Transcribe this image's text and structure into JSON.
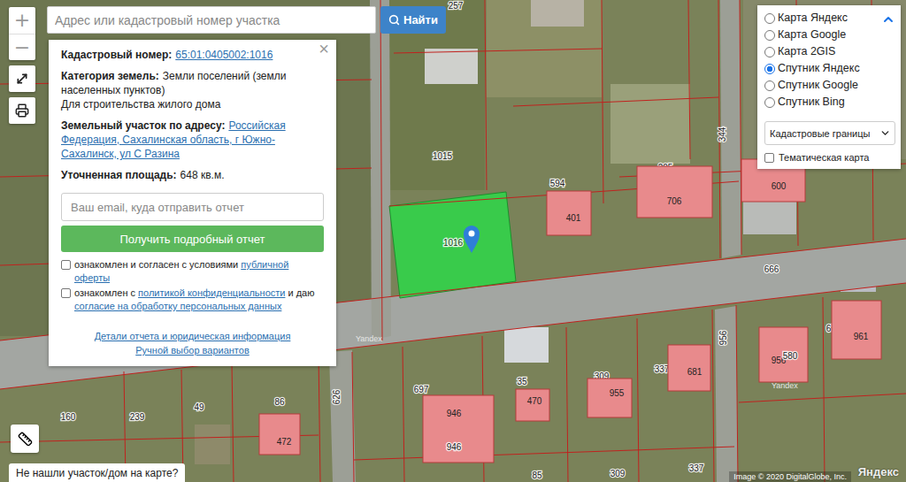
{
  "search": {
    "placeholder": "Адрес или кадастровый номер участка",
    "button": "Найти"
  },
  "zoom": {
    "in": "+",
    "out": "−"
  },
  "info_panel": {
    "close": "×",
    "cadastral_number": {
      "label": "Кадастровый номер:",
      "value": "65:01:0405002:1016"
    },
    "category": {
      "label": "Категория земель:",
      "value": "Земли поселений (земли населенных пунктов)",
      "purpose": "Для строительства жилого дома"
    },
    "address": {
      "label": "Земельный участок по адресу:",
      "value": "Российская Федерация, Сахалинская область, г Южно-Сахалинск, ул С Разина"
    },
    "area": {
      "label": "Уточненная площадь:",
      "value": "648 кв.м."
    },
    "email_placeholder": "Ваш email, куда отправить отчет",
    "report_button": "Получить подробный отчет",
    "agreements": [
      {
        "checked": false,
        "parts": [
          {
            "text": "ознакомлен и согласен с условиями ",
            "link": false
          },
          {
            "text": "публичной оферты",
            "link": true
          }
        ]
      },
      {
        "checked": false,
        "parts": [
          {
            "text": "ознакомлен с ",
            "link": false
          },
          {
            "text": "политикой конфиденциальности",
            "link": true
          },
          {
            "text": " и даю ",
            "link": false
          },
          {
            "text": "согласие на обработку персональных данных",
            "link": true
          }
        ]
      }
    ],
    "links": [
      "Детали отчета и юридическая информация",
      "Ручной выбор вариантов"
    ]
  },
  "layers": {
    "options": [
      {
        "label": "Карта Яндекс",
        "selected": false
      },
      {
        "label": "Карта Google",
        "selected": false
      },
      {
        "label": "Карта 2GIS",
        "selected": false
      },
      {
        "label": "Спутник Яндекс",
        "selected": true
      },
      {
        "label": "Спутник Google",
        "selected": false
      },
      {
        "label": "Спутник Bing",
        "selected": false
      }
    ],
    "overlay_select": "Кадастровые границы",
    "thematic": {
      "label": "Тематическая карта",
      "checked": false
    }
  },
  "map": {
    "labels": [
      {
        "text": "257",
        "kind": "parcel"
      },
      {
        "text": "1015",
        "kind": "parcel"
      },
      {
        "text": "1016",
        "kind": "selected"
      },
      {
        "text": "594",
        "kind": "parcel"
      },
      {
        "text": "401",
        "kind": "building"
      },
      {
        "text": "205",
        "kind": "parcel"
      },
      {
        "text": "706",
        "kind": "building"
      },
      {
        "text": "344",
        "kind": "road"
      },
      {
        "text": "600",
        "kind": "building"
      },
      {
        "text": "666",
        "kind": "parcel"
      },
      {
        "text": "697",
        "kind": "parcel"
      },
      {
        "text": "946",
        "kind": "building"
      },
      {
        "text": "946",
        "kind": "parcel"
      },
      {
        "text": "35",
        "kind": "parcel"
      },
      {
        "text": "470",
        "kind": "building"
      },
      {
        "text": "309",
        "kind": "parcel"
      },
      {
        "text": "955",
        "kind": "building"
      },
      {
        "text": "337",
        "kind": "parcel"
      },
      {
        "text": "681",
        "kind": "building"
      },
      {
        "text": "956",
        "kind": "road"
      },
      {
        "text": "956",
        "kind": "building"
      },
      {
        "text": "580",
        "kind": "parcel"
      },
      {
        "text": "675",
        "kind": "parcel"
      },
      {
        "text": "961",
        "kind": "building"
      },
      {
        "text": "160",
        "kind": "parcel"
      },
      {
        "text": "239",
        "kind": "parcel"
      },
      {
        "text": "49",
        "kind": "parcel"
      },
      {
        "text": "86",
        "kind": "parcel"
      },
      {
        "text": "472",
        "kind": "building"
      },
      {
        "text": "626",
        "kind": "road"
      },
      {
        "text": "309",
        "kind": "parcel"
      },
      {
        "text": "337",
        "kind": "parcel"
      },
      {
        "text": "85",
        "kind": "parcel"
      }
    ],
    "watermarks": [
      "Yandex",
      "Yandex"
    ],
    "copyright": "Image © 2020 DigitalGlobe, Inc.",
    "logo": "Яндекс"
  },
  "footer": {
    "not_found": "Не нашли участок/дом на карте?"
  }
}
